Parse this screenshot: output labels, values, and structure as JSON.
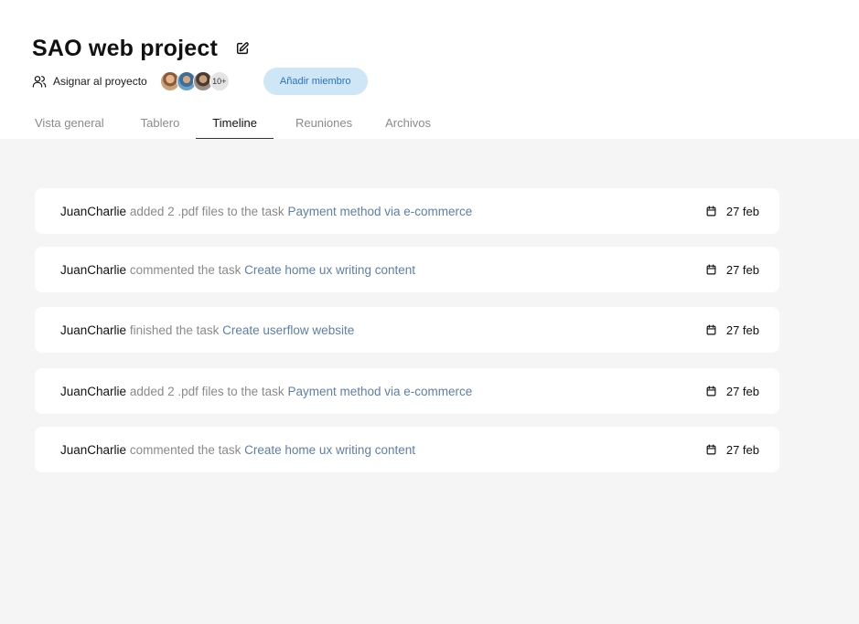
{
  "project": {
    "title": "SAO web project",
    "assign_label": "Asignar al proyecto",
    "avatars_more": "10+",
    "add_member_label": "Añadir miembro"
  },
  "tabs": [
    {
      "label": "Vista general",
      "active": false
    },
    {
      "label": "Tablero",
      "active": false
    },
    {
      "label": "Timeline",
      "active": true
    },
    {
      "label": "Reuniones",
      "active": false
    },
    {
      "label": "Archivos",
      "active": false
    }
  ],
  "timeline": [
    {
      "user": "JuanCharlie",
      "action": "added 2 .pdf files to the task",
      "task": "Payment method via e-commerce",
      "date": "27 feb"
    },
    {
      "user": "JuanCharlie",
      "action": "commented the task",
      "task": "Create home ux writing content",
      "date": "27 feb"
    },
    {
      "user": "JuanCharlie",
      "action": "finished the task",
      "task": "Create userflow website",
      "date": "27 feb"
    },
    {
      "user": "JuanCharlie",
      "action": "added 2 .pdf files to the task",
      "task": "Payment method via e-commerce",
      "date": "27 feb"
    },
    {
      "user": "JuanCharlie",
      "action": "commented the task",
      "task": "Create home ux writing content",
      "date": "27 feb"
    }
  ],
  "colors": {
    "accent": "#2b73ba",
    "accent_bg": "#cfe6f7",
    "task_link": "#5d7eaa",
    "content_bg": "#f5f5f5"
  },
  "icons": {
    "edit": "edit-icon",
    "assign": "users-icon",
    "date": "calendar-icon"
  }
}
